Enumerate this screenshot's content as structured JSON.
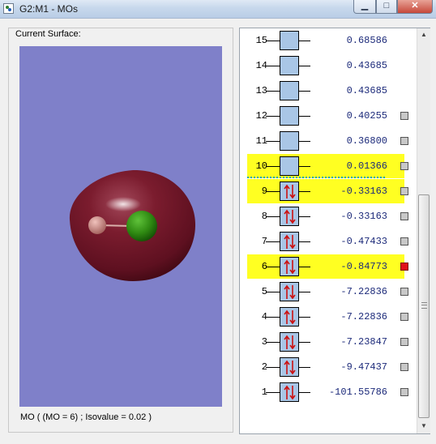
{
  "window": {
    "title": "G2:M1 - MOs",
    "minimize_glyph": "▁",
    "maximize_glyph": "□",
    "close_glyph": "✕"
  },
  "surface_panel": {
    "label": "Current Surface:",
    "caption": "MO ( (MO = 6) ; Isovalue = 0.02 )",
    "colors": {
      "background": "#7f80c9",
      "lobe": "#6e1626",
      "atom_h": "#c48a85",
      "atom_cl": "#2f8a12"
    }
  },
  "mo_list": {
    "orbitals": [
      {
        "number": "15",
        "energy": "0.68586",
        "occupied": false,
        "highlight": false,
        "selector": "none"
      },
      {
        "number": "14",
        "energy": "0.43685",
        "occupied": false,
        "highlight": false,
        "selector": "none"
      },
      {
        "number": "13",
        "energy": "0.43685",
        "occupied": false,
        "highlight": false,
        "selector": "none"
      },
      {
        "number": "12",
        "energy": "0.40255",
        "occupied": false,
        "highlight": false,
        "selector": "grey"
      },
      {
        "number": "11",
        "energy": "0.36800",
        "occupied": false,
        "highlight": false,
        "selector": "grey"
      },
      {
        "number": "10",
        "energy": "0.01366",
        "occupied": false,
        "highlight": true,
        "selector": "grey"
      },
      {
        "number": "9",
        "energy": "-0.33163",
        "occupied": true,
        "highlight": true,
        "selector": "grey"
      },
      {
        "number": "8",
        "energy": "-0.33163",
        "occupied": true,
        "highlight": false,
        "selector": "grey"
      },
      {
        "number": "7",
        "energy": "-0.47433",
        "occupied": true,
        "highlight": false,
        "selector": "grey"
      },
      {
        "number": "6",
        "energy": "-0.84773",
        "occupied": true,
        "highlight": true,
        "selector": "red"
      },
      {
        "number": "5",
        "energy": "-7.22836",
        "occupied": true,
        "highlight": false,
        "selector": "grey"
      },
      {
        "number": "4",
        "energy": "-7.22836",
        "occupied": true,
        "highlight": false,
        "selector": "grey"
      },
      {
        "number": "3",
        "energy": "-7.23847",
        "occupied": true,
        "highlight": false,
        "selector": "grey"
      },
      {
        "number": "2",
        "energy": "-9.47437",
        "occupied": true,
        "highlight": false,
        "selector": "grey"
      },
      {
        "number": "1",
        "energy": "-101.55786",
        "occupied": true,
        "highlight": false,
        "selector": "grey"
      }
    ],
    "colors": {
      "highlight": "#ffff22",
      "orbital_box": "#a9c6e6",
      "electron_arrow": "#cc1111",
      "homo_lumo_divider": "#16a8b0",
      "selected_marker": "#e0101a"
    }
  },
  "scrollbar": {
    "up_glyph": "▲",
    "down_glyph": "▼"
  }
}
